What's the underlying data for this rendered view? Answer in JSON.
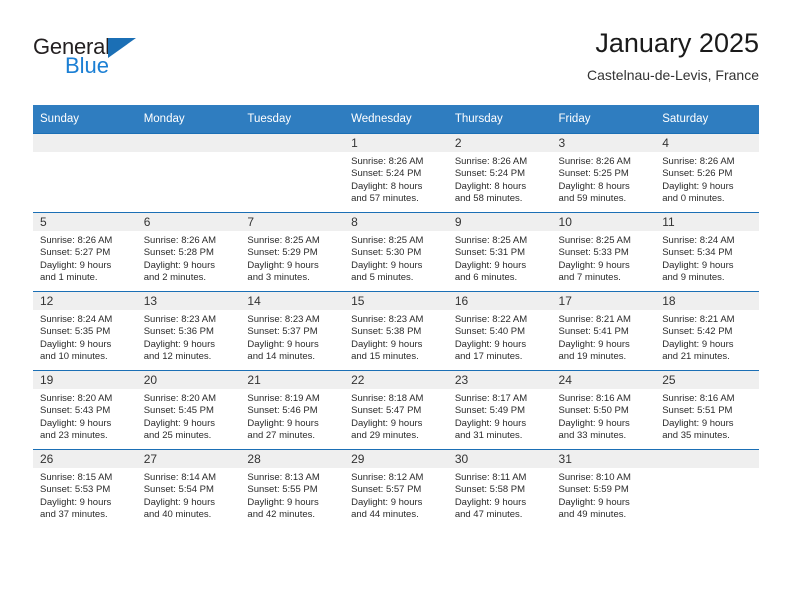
{
  "brand": {
    "name_part1": "General",
    "name_part2": "Blue",
    "triangle_color": "#1b6fb5",
    "blue_color": "#1b7fd4"
  },
  "header": {
    "title": "January 2025",
    "subtitle": "Castelnau-de-Levis, France"
  },
  "colors": {
    "header_row_bg": "#2f7dc0",
    "daynum_strip_bg": "#efefef",
    "cell_border": "#1b6fb5",
    "text": "#2b2b2b"
  },
  "weekdays": [
    "Sunday",
    "Monday",
    "Tuesday",
    "Wednesday",
    "Thursday",
    "Friday",
    "Saturday"
  ],
  "weeks": [
    [
      {
        "day": "",
        "sunrise": "",
        "sunset": "",
        "daylight1": "",
        "daylight2": "",
        "empty": true
      },
      {
        "day": "",
        "sunrise": "",
        "sunset": "",
        "daylight1": "",
        "daylight2": "",
        "empty": true
      },
      {
        "day": "",
        "sunrise": "",
        "sunset": "",
        "daylight1": "",
        "daylight2": "",
        "empty": true
      },
      {
        "day": "1",
        "sunrise": "Sunrise: 8:26 AM",
        "sunset": "Sunset: 5:24 PM",
        "daylight1": "Daylight: 8 hours",
        "daylight2": "and 57 minutes."
      },
      {
        "day": "2",
        "sunrise": "Sunrise: 8:26 AM",
        "sunset": "Sunset: 5:24 PM",
        "daylight1": "Daylight: 8 hours",
        "daylight2": "and 58 minutes."
      },
      {
        "day": "3",
        "sunrise": "Sunrise: 8:26 AM",
        "sunset": "Sunset: 5:25 PM",
        "daylight1": "Daylight: 8 hours",
        "daylight2": "and 59 minutes."
      },
      {
        "day": "4",
        "sunrise": "Sunrise: 8:26 AM",
        "sunset": "Sunset: 5:26 PM",
        "daylight1": "Daylight: 9 hours",
        "daylight2": "and 0 minutes."
      }
    ],
    [
      {
        "day": "5",
        "sunrise": "Sunrise: 8:26 AM",
        "sunset": "Sunset: 5:27 PM",
        "daylight1": "Daylight: 9 hours",
        "daylight2": "and 1 minute."
      },
      {
        "day": "6",
        "sunrise": "Sunrise: 8:26 AM",
        "sunset": "Sunset: 5:28 PM",
        "daylight1": "Daylight: 9 hours",
        "daylight2": "and 2 minutes."
      },
      {
        "day": "7",
        "sunrise": "Sunrise: 8:25 AM",
        "sunset": "Sunset: 5:29 PM",
        "daylight1": "Daylight: 9 hours",
        "daylight2": "and 3 minutes."
      },
      {
        "day": "8",
        "sunrise": "Sunrise: 8:25 AM",
        "sunset": "Sunset: 5:30 PM",
        "daylight1": "Daylight: 9 hours",
        "daylight2": "and 5 minutes."
      },
      {
        "day": "9",
        "sunrise": "Sunrise: 8:25 AM",
        "sunset": "Sunset: 5:31 PM",
        "daylight1": "Daylight: 9 hours",
        "daylight2": "and 6 minutes."
      },
      {
        "day": "10",
        "sunrise": "Sunrise: 8:25 AM",
        "sunset": "Sunset: 5:33 PM",
        "daylight1": "Daylight: 9 hours",
        "daylight2": "and 7 minutes."
      },
      {
        "day": "11",
        "sunrise": "Sunrise: 8:24 AM",
        "sunset": "Sunset: 5:34 PM",
        "daylight1": "Daylight: 9 hours",
        "daylight2": "and 9 minutes."
      }
    ],
    [
      {
        "day": "12",
        "sunrise": "Sunrise: 8:24 AM",
        "sunset": "Sunset: 5:35 PM",
        "daylight1": "Daylight: 9 hours",
        "daylight2": "and 10 minutes."
      },
      {
        "day": "13",
        "sunrise": "Sunrise: 8:23 AM",
        "sunset": "Sunset: 5:36 PM",
        "daylight1": "Daylight: 9 hours",
        "daylight2": "and 12 minutes."
      },
      {
        "day": "14",
        "sunrise": "Sunrise: 8:23 AM",
        "sunset": "Sunset: 5:37 PM",
        "daylight1": "Daylight: 9 hours",
        "daylight2": "and 14 minutes."
      },
      {
        "day": "15",
        "sunrise": "Sunrise: 8:23 AM",
        "sunset": "Sunset: 5:38 PM",
        "daylight1": "Daylight: 9 hours",
        "daylight2": "and 15 minutes."
      },
      {
        "day": "16",
        "sunrise": "Sunrise: 8:22 AM",
        "sunset": "Sunset: 5:40 PM",
        "daylight1": "Daylight: 9 hours",
        "daylight2": "and 17 minutes."
      },
      {
        "day": "17",
        "sunrise": "Sunrise: 8:21 AM",
        "sunset": "Sunset: 5:41 PM",
        "daylight1": "Daylight: 9 hours",
        "daylight2": "and 19 minutes."
      },
      {
        "day": "18",
        "sunrise": "Sunrise: 8:21 AM",
        "sunset": "Sunset: 5:42 PM",
        "daylight1": "Daylight: 9 hours",
        "daylight2": "and 21 minutes."
      }
    ],
    [
      {
        "day": "19",
        "sunrise": "Sunrise: 8:20 AM",
        "sunset": "Sunset: 5:43 PM",
        "daylight1": "Daylight: 9 hours",
        "daylight2": "and 23 minutes."
      },
      {
        "day": "20",
        "sunrise": "Sunrise: 8:20 AM",
        "sunset": "Sunset: 5:45 PM",
        "daylight1": "Daylight: 9 hours",
        "daylight2": "and 25 minutes."
      },
      {
        "day": "21",
        "sunrise": "Sunrise: 8:19 AM",
        "sunset": "Sunset: 5:46 PM",
        "daylight1": "Daylight: 9 hours",
        "daylight2": "and 27 minutes."
      },
      {
        "day": "22",
        "sunrise": "Sunrise: 8:18 AM",
        "sunset": "Sunset: 5:47 PM",
        "daylight1": "Daylight: 9 hours",
        "daylight2": "and 29 minutes."
      },
      {
        "day": "23",
        "sunrise": "Sunrise: 8:17 AM",
        "sunset": "Sunset: 5:49 PM",
        "daylight1": "Daylight: 9 hours",
        "daylight2": "and 31 minutes."
      },
      {
        "day": "24",
        "sunrise": "Sunrise: 8:16 AM",
        "sunset": "Sunset: 5:50 PM",
        "daylight1": "Daylight: 9 hours",
        "daylight2": "and 33 minutes."
      },
      {
        "day": "25",
        "sunrise": "Sunrise: 8:16 AM",
        "sunset": "Sunset: 5:51 PM",
        "daylight1": "Daylight: 9 hours",
        "daylight2": "and 35 minutes."
      }
    ],
    [
      {
        "day": "26",
        "sunrise": "Sunrise: 8:15 AM",
        "sunset": "Sunset: 5:53 PM",
        "daylight1": "Daylight: 9 hours",
        "daylight2": "and 37 minutes."
      },
      {
        "day": "27",
        "sunrise": "Sunrise: 8:14 AM",
        "sunset": "Sunset: 5:54 PM",
        "daylight1": "Daylight: 9 hours",
        "daylight2": "and 40 minutes."
      },
      {
        "day": "28",
        "sunrise": "Sunrise: 8:13 AM",
        "sunset": "Sunset: 5:55 PM",
        "daylight1": "Daylight: 9 hours",
        "daylight2": "and 42 minutes."
      },
      {
        "day": "29",
        "sunrise": "Sunrise: 8:12 AM",
        "sunset": "Sunset: 5:57 PM",
        "daylight1": "Daylight: 9 hours",
        "daylight2": "and 44 minutes."
      },
      {
        "day": "30",
        "sunrise": "Sunrise: 8:11 AM",
        "sunset": "Sunset: 5:58 PM",
        "daylight1": "Daylight: 9 hours",
        "daylight2": "and 47 minutes."
      },
      {
        "day": "31",
        "sunrise": "Sunrise: 8:10 AM",
        "sunset": "Sunset: 5:59 PM",
        "daylight1": "Daylight: 9 hours",
        "daylight2": "and 49 minutes."
      },
      {
        "day": "",
        "sunrise": "",
        "sunset": "",
        "daylight1": "",
        "daylight2": "",
        "empty": true
      }
    ]
  ]
}
